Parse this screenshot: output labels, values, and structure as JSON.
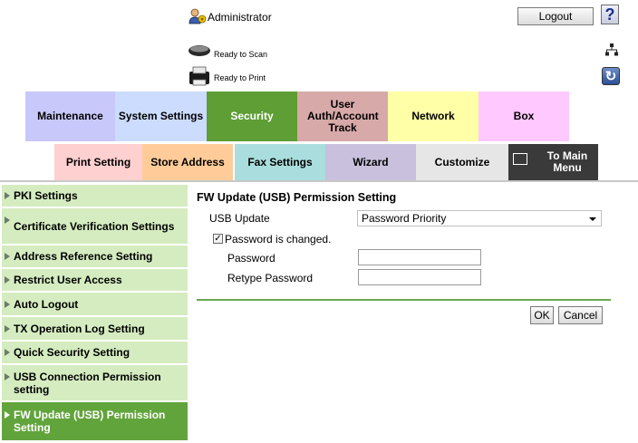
{
  "header": {
    "user_label": "Administrator",
    "logout_label": "Logout",
    "help_label": "?",
    "scan_status": "Ready to Scan",
    "print_status": "Ready to Print"
  },
  "tabs_row1": [
    {
      "label": "Maintenance",
      "color": "#c8c8fa"
    },
    {
      "label": "System Settings",
      "color": "#ccdcff"
    },
    {
      "label": "Security",
      "color": "#5e9e35"
    },
    {
      "label": "User Auth/Account Track",
      "color": "#d8a9a9"
    },
    {
      "label": "Network",
      "color": "#ffffa8"
    },
    {
      "label": "Box",
      "color": "#ffc8ff"
    }
  ],
  "tabs_row2": [
    {
      "label": "Print Setting",
      "color": "#ffd0d0"
    },
    {
      "label": "Store Address",
      "color": "#ffcc99"
    },
    {
      "label": "Fax Settings",
      "color": "#aadddd"
    },
    {
      "label": "Wizard",
      "color": "#c8c0dc"
    },
    {
      "label": "Customize",
      "color": "#e6e6e6"
    },
    {
      "label": "To Main Menu",
      "color": "#3a3a3a"
    }
  ],
  "sidebar": {
    "items": [
      {
        "label": "PKI Settings"
      },
      {
        "label": "Certificate Verification Settings"
      },
      {
        "label": "Address Reference Setting"
      },
      {
        "label": "Restrict User Access"
      },
      {
        "label": "Auto Logout"
      },
      {
        "label": "TX Operation Log Setting"
      },
      {
        "label": "Quick Security Setting"
      },
      {
        "label": "USB Connection Permission setting"
      },
      {
        "label": "FW Update (USB) Permission Setting"
      }
    ]
  },
  "main": {
    "title": "FW Update (USB) Permission Setting",
    "usb_update_label": "USB Update",
    "usb_update_value": "Password Priority",
    "password_changed_label": "Password is changed.",
    "password_label": "Password",
    "retype_password_label": "Retype Password",
    "ok_label": "OK",
    "cancel_label": "Cancel"
  }
}
